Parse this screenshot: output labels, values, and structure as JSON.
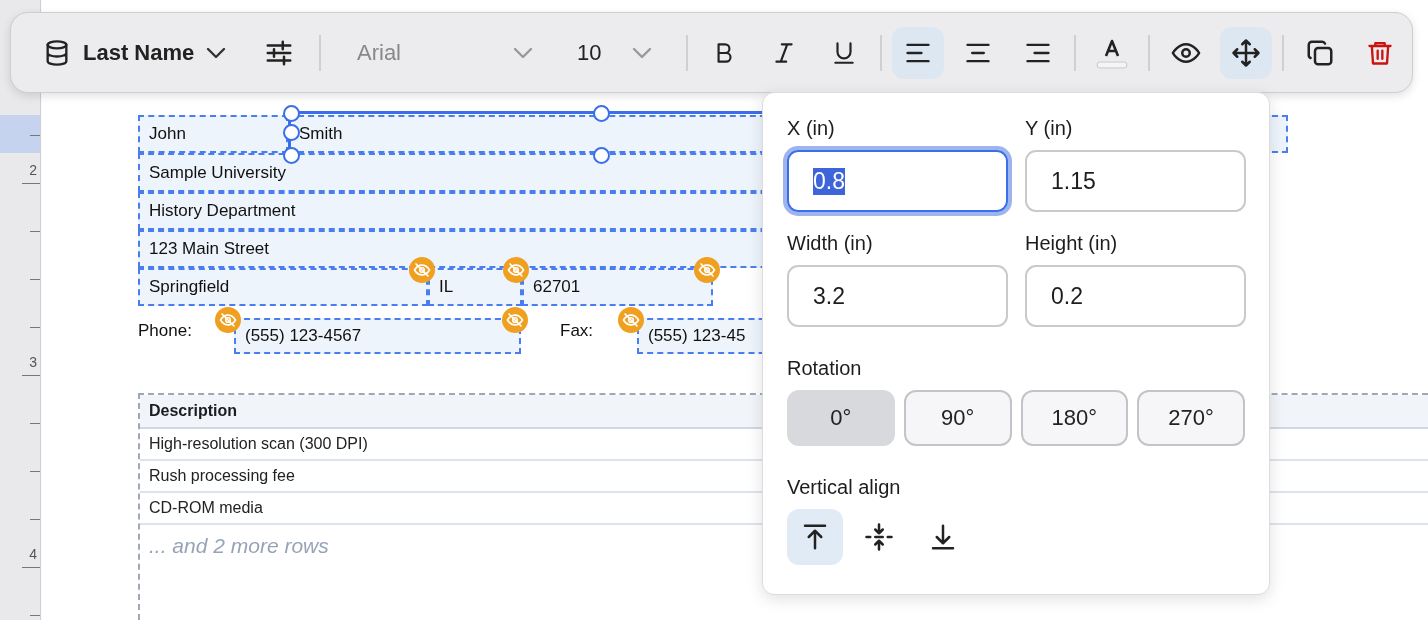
{
  "toolbar": {
    "field_select": {
      "label": "Last Name"
    },
    "font": {
      "value": "Arial"
    },
    "size": {
      "value": "10"
    },
    "button_groups": [
      [
        {
          "kind": "bold",
          "selected": false
        },
        {
          "kind": "italic",
          "selected": false
        },
        {
          "kind": "underline",
          "selected": false
        }
      ],
      [
        {
          "kind": "align-left",
          "selected": true
        },
        {
          "kind": "align-center",
          "selected": false
        },
        {
          "kind": "align-right",
          "selected": false
        }
      ],
      [
        {
          "kind": "text-color",
          "selected": false
        }
      ],
      [
        {
          "kind": "visibility",
          "selected": false
        },
        {
          "kind": "move",
          "selected": true
        }
      ],
      [
        {
          "kind": "duplicate",
          "selected": false
        },
        {
          "kind": "delete",
          "selected": false
        }
      ]
    ]
  },
  "ruler": {
    "labels": [
      "2",
      "3",
      "4"
    ]
  },
  "fields": [
    {
      "kind": "field",
      "text": "John",
      "hidden": false,
      "selected": false
    },
    {
      "kind": "field",
      "text": "Smith",
      "hidden": false,
      "selected": true
    },
    {
      "kind": "field",
      "text": "Sample University",
      "hidden": false,
      "selected": false
    },
    {
      "kind": "field",
      "text": "History Department",
      "hidden": false,
      "selected": false
    },
    {
      "kind": "field",
      "text": "123 Main Street",
      "hidden": false,
      "selected": false
    },
    {
      "kind": "field",
      "text": "Springfield",
      "hidden": true,
      "selected": false
    },
    {
      "kind": "field",
      "text": "IL",
      "hidden": true,
      "selected": false
    },
    {
      "kind": "field",
      "text": "62701",
      "hidden": true,
      "selected": false
    },
    {
      "kind": "label",
      "text": "Phone:",
      "hidden": true,
      "selected": false
    },
    {
      "kind": "field",
      "text": "(555) 123-4567",
      "hidden": true,
      "selected": false
    },
    {
      "kind": "label",
      "text": "Fax:",
      "hidden": true,
      "selected": false
    },
    {
      "kind": "field",
      "text": "(555) 123-45",
      "hidden": false,
      "selected": false
    }
  ],
  "table": {
    "columns": [
      "Description"
    ],
    "rows": [
      [
        "High-resolution scan (300 DPI)"
      ],
      [
        "Rush processing fee"
      ],
      [
        "CD-ROM media"
      ]
    ],
    "more_rows": "... and 2 more rows"
  },
  "popover": {
    "inputs": [
      {
        "label": "X (in)",
        "value": "0.8",
        "focused": true
      },
      {
        "label": "Y (in)",
        "value": "1.15",
        "focused": false
      },
      {
        "label": "Width (in)",
        "value": "3.2",
        "focused": false
      },
      {
        "label": "Height (in)",
        "value": "0.2",
        "focused": false
      }
    ],
    "rotation": {
      "label": "Rotation",
      "options": [
        {
          "label": "0°",
          "selected": true
        },
        {
          "label": "90°",
          "selected": false
        },
        {
          "label": "180°",
          "selected": false
        },
        {
          "label": "270°",
          "selected": false
        }
      ]
    },
    "vertical_align": {
      "label": "Vertical align",
      "options": [
        {
          "kind": "top",
          "selected": true
        },
        {
          "kind": "middle",
          "selected": false
        },
        {
          "kind": "bottom",
          "selected": false
        }
      ]
    }
  }
}
